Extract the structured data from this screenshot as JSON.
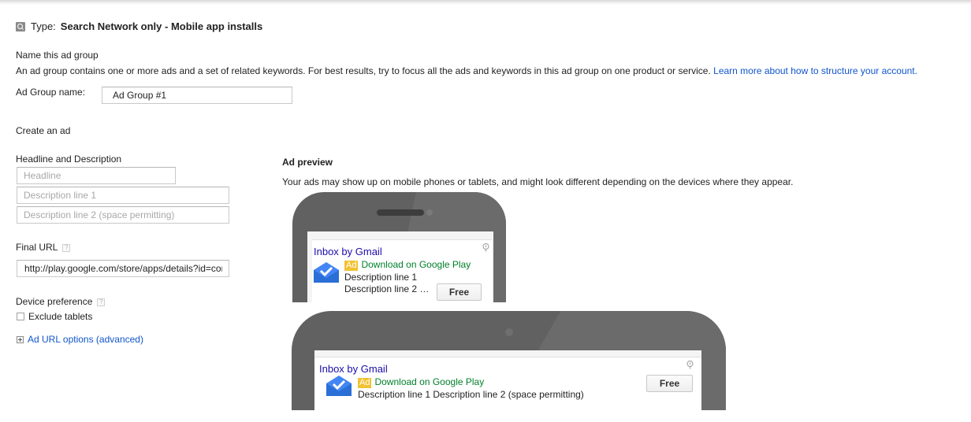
{
  "type": {
    "label": "Type:",
    "value": "Search Network only - Mobile app installs"
  },
  "ad_group": {
    "section_title": "Name this ad group",
    "description": "An ad group contains one or more ads and a set of related keywords. For best results, try to focus all the ads and keywords in this ad group on one product or service.",
    "learn_more": "Learn more about how to structure your account.",
    "name_label": "Ad Group name:",
    "name_value": "Ad Group #1"
  },
  "create_ad": {
    "section_title": "Create an ad",
    "headline_desc_label": "Headline and Description",
    "headline_placeholder": "Headline",
    "desc1_placeholder": "Description line 1",
    "desc2_placeholder": "Description line 2 (space permitting)",
    "final_url_label": "Final URL",
    "final_url_value": "http://play.google.com/store/apps/details?id=com",
    "help_glyph": "?",
    "device_pref_label": "Device preference",
    "exclude_tablets_label": "Exclude tablets",
    "ad_url_options": "Ad URL options (advanced)"
  },
  "preview": {
    "title": "Ad preview",
    "note": "Your ads may show up on mobile phones or tablets, and might look different depending on the devices where they appear.",
    "phone": {
      "headline": "Inbox by Gmail",
      "badge": "Ad",
      "url": "Download on Google Play",
      "desc1": "Description line 1",
      "desc2": "Description line 2 …",
      "button": "Free"
    },
    "tablet": {
      "headline": "Inbox by Gmail",
      "badge": "Ad",
      "url": "Download on Google Play",
      "desc": "Description line 1 Description line 2 (space permitting)",
      "button": "Free"
    }
  },
  "colors": {
    "link": "#1155cc",
    "ad_headline": "#1a0dab",
    "ad_url": "#00802b",
    "ad_badge": "#f1c232",
    "phone_body": "#616161"
  },
  "icons": {
    "type": "search-network-icon",
    "app": "inbox-app-icon",
    "info": "info-pin-icon"
  }
}
